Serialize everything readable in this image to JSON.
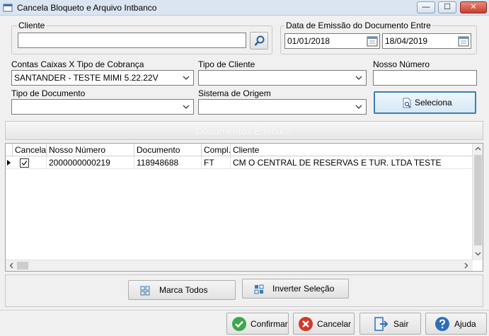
{
  "window": {
    "title": "Cancela Bloqueto e Arquivo Intbanco",
    "minimize_glyph": "—",
    "maximize_glyph": "☐",
    "close_glyph": "✕"
  },
  "cliente": {
    "group_label": "Cliente",
    "value": ""
  },
  "data_emissao": {
    "group_label": "Data de Emissão do Documento Entre",
    "start": "01/01/2018",
    "end": "18/04/2019"
  },
  "filters": {
    "contas_label": "Contas Caixas X Tipo de Cobrança",
    "contas_value": "SANTANDER - TESTE MIMI 5.22.22V",
    "tipo_cliente_label": "Tipo de Cliente",
    "tipo_cliente_value": "",
    "nosso_numero_label": "Nosso Número",
    "nosso_numero_value": "",
    "tipo_documento_label": "Tipo de Documento",
    "tipo_documento_value": "",
    "sistema_origem_label": "Sistema de Origem",
    "sistema_origem_value": "",
    "seleciona_label": "Seleciona"
  },
  "section": {
    "title": "Documentos Emitidos"
  },
  "grid": {
    "columns": [
      "Cancela",
      "Nosso Número",
      "Documento",
      "Compl.",
      "Cliente"
    ],
    "rows": [
      {
        "cancela": true,
        "nosso_numero": "2000000000219",
        "documento": "118948688",
        "compl": "FT",
        "cliente": "CM  O CENTRAL DE RESERVAS E TUR. LTDA TESTE"
      }
    ]
  },
  "actions": {
    "marca_todos": "Marca Todos",
    "inverter_selecao": "Inverter Seleção"
  },
  "footer": {
    "confirmar": "Confirmar",
    "cancelar": "Cancelar",
    "sair": "Sair",
    "ajuda": "Ajuda"
  },
  "colors": {
    "titlebar": "#dbe5f1",
    "confirm_green": "#3aa84a",
    "cancel_red": "#d23a2b",
    "help_blue": "#2d6fb5",
    "focus_border": "#3c7fb1"
  },
  "icons": {
    "app": "app-icon",
    "search": "search-icon",
    "calendar": "calendar-icon",
    "seleciona": "document-search-icon",
    "marca_todos": "grid-icon",
    "inverter": "invert-selection-icon",
    "confirmar": "check-circle-icon",
    "cancelar": "cancel-circle-icon",
    "sair": "exit-door-icon",
    "ajuda": "help-circle-icon"
  }
}
